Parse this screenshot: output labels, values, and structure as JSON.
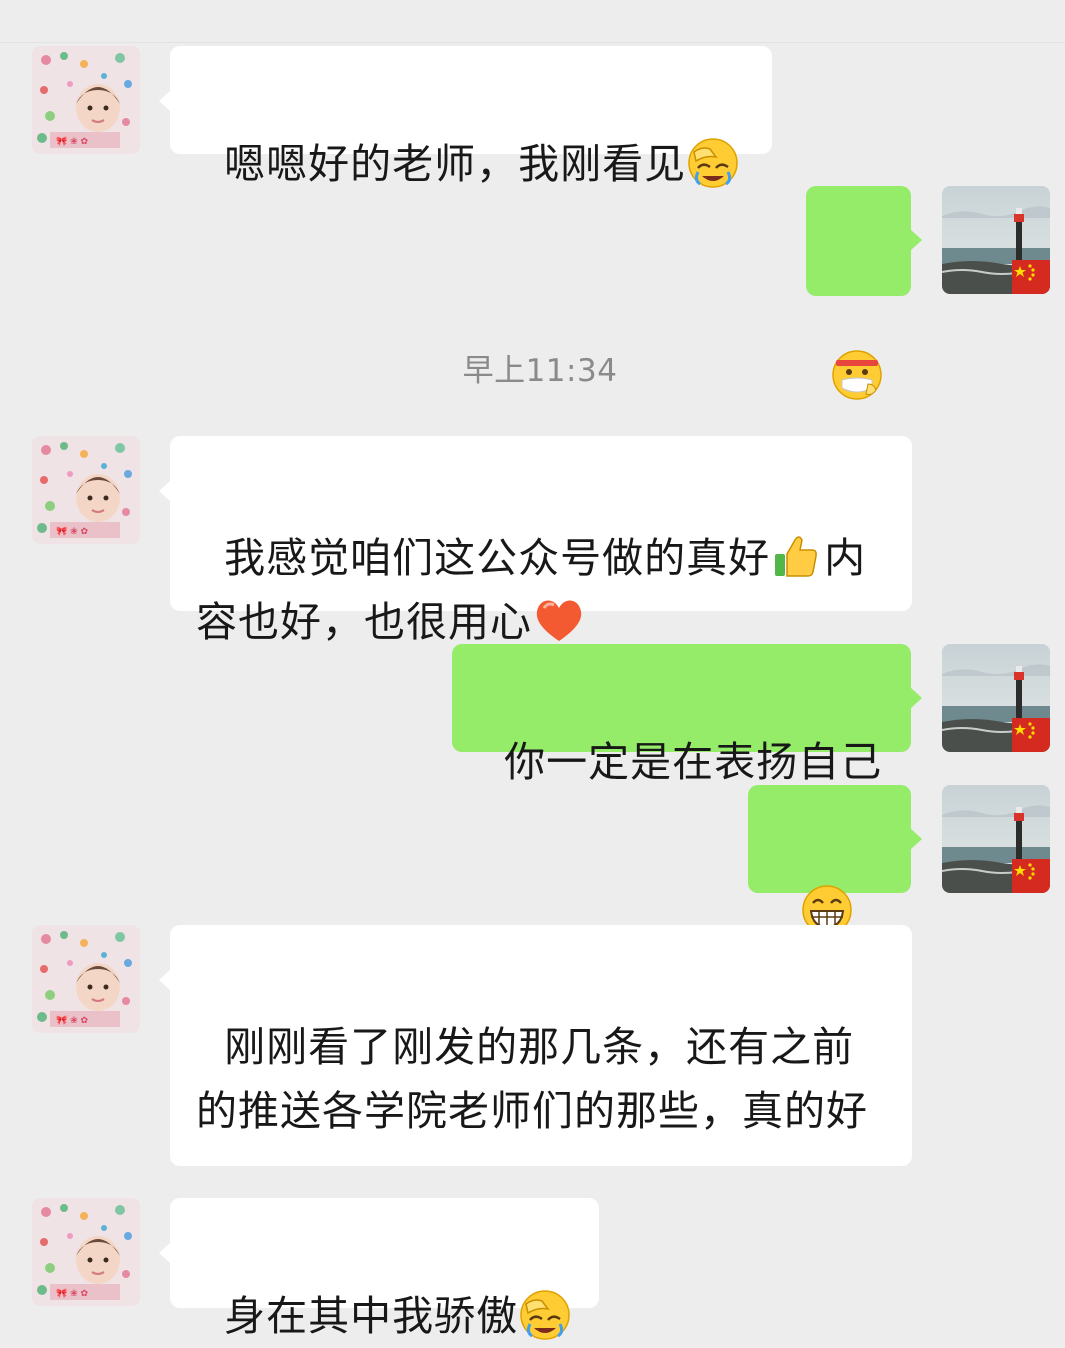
{
  "chat": {
    "timestamp": "早上11:34",
    "messages": [
      {
        "side": "them",
        "text_before": "嗯嗯好的老师，我刚看见",
        "emoji": "facepalm-emoji",
        "text_after": ""
      },
      {
        "side": "me",
        "emoji": "mask-emoji"
      },
      {
        "side": "them",
        "text_before": "我感觉咱们这公众号做的真好",
        "emoji1": "thumbs-up-emoji",
        "text_mid": "内容也好，也很用心",
        "emoji2": "heart-emoji"
      },
      {
        "side": "me",
        "text": "你一定是在表扬自己"
      },
      {
        "side": "me",
        "emoji": "grin-emoji grin-emoji"
      },
      {
        "side": "them",
        "text": "刚刚看了刚发的那几条，还有之前的推送各学院老师们的那些，真的好"
      },
      {
        "side": "them",
        "text_before": "身在其中我骄傲",
        "emoji": "facepalm-emoji"
      }
    ]
  },
  "colors": {
    "background": "#ededed",
    "my_bubble": "#95ec69",
    "their_bubble": "#ffffff",
    "timestamp": "#8a8a8a"
  }
}
